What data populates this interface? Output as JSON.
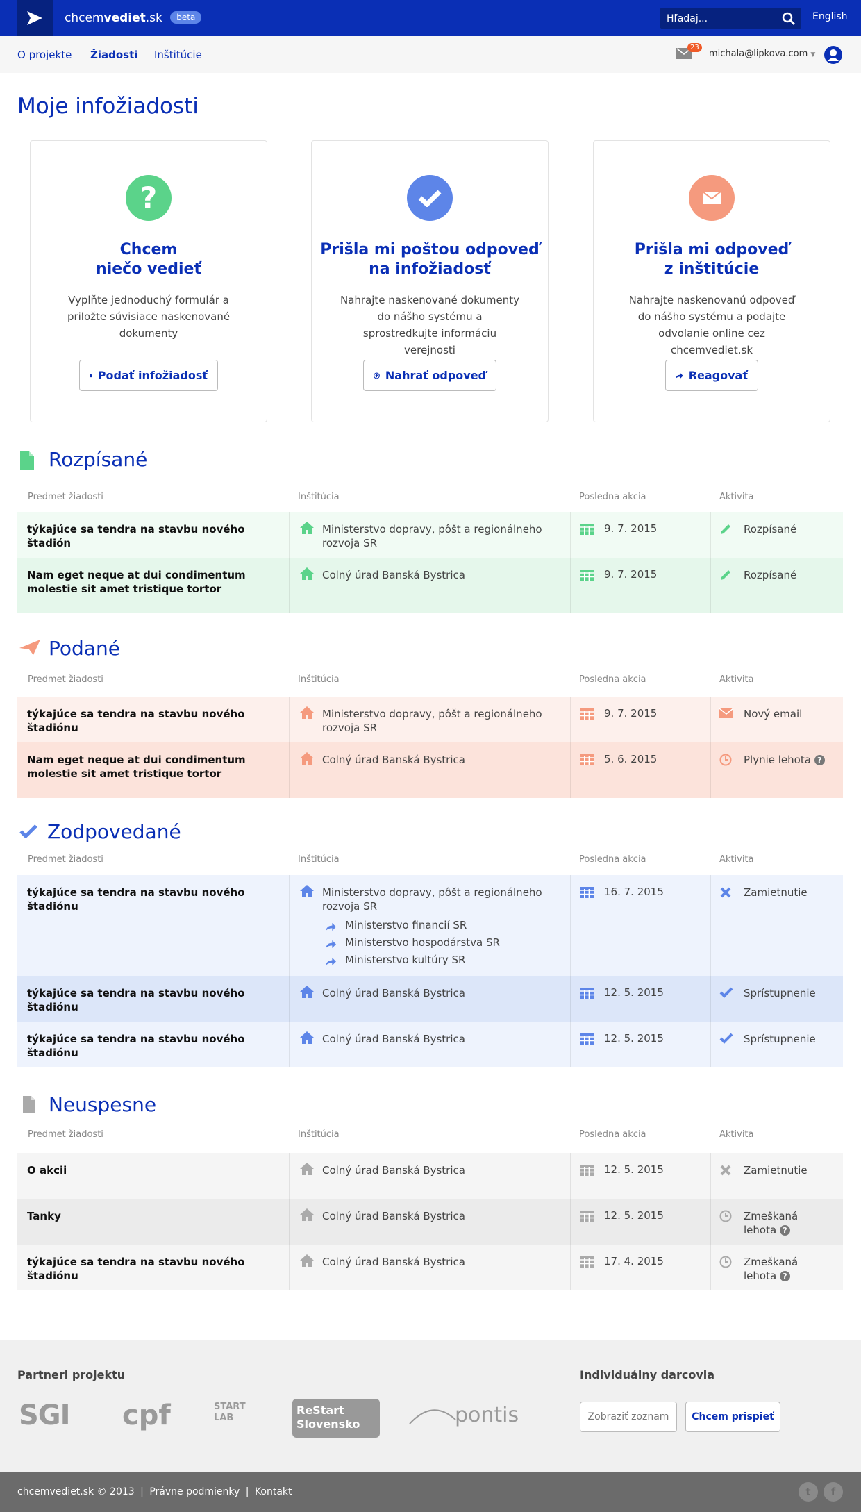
{
  "header": {
    "brand_light": "chcem",
    "brand_bold": "vediet",
    "brand_tld": ".sk",
    "beta": "beta",
    "search_placeholder": "Hľadaj...",
    "lang": "English"
  },
  "nav": {
    "items": [
      "O projekte",
      "Žiadosti",
      "Inštitúcie"
    ],
    "mail_count": "23",
    "user": "michala@lipkova.com"
  },
  "page_title": "Moje infožiadosti",
  "cards": [
    {
      "title1": "Chcem",
      "title2": "niečo vedieť",
      "text": "Vyplňte jednoduchý formulár a priložte súvisiace naskenované dokumenty",
      "button": "Podať infožiadosť",
      "color": "#5bd38a"
    },
    {
      "title1": "Prišla mi poštou odpoveď",
      "title2": "na infožiadosť",
      "text": "Nahrajte naskenované dokumenty do nášho systému a sprostredkujte informáciu verejnosti",
      "button": "Nahrať odpoveď",
      "color": "#5d85e8"
    },
    {
      "title1": "Prišla mi odpoveď",
      "title2": "z inštitúcie",
      "text": "Nahrajte naskenovanú odpoveď do nášho systému a podajte odvolanie online cez chcemvediet.sk",
      "button": "Reagovať",
      "color": "#f59a7e"
    }
  ],
  "table_headers": [
    "Predmet žiadosti",
    "Inštitúcia",
    "Posledna akcia",
    "Aktivita"
  ],
  "sections": {
    "rozpisane": {
      "title": "Rozpísané",
      "rows": [
        {
          "subject": "týkajúce sa tendra na stavbu nového štadión",
          "institution": "Ministerstvo dopravy, pôšt a regionálneho rozvoja SR",
          "date": "9. 7. 2015",
          "activity": "Rozpísané"
        },
        {
          "subject": "Nam eget neque at dui condimentum molestie sit amet tristique tortor",
          "institution": "Colný úrad Banská Bystrica",
          "date": "9. 7. 2015",
          "activity": "Rozpísané"
        }
      ]
    },
    "podane": {
      "title": "Podané",
      "rows": [
        {
          "subject": "týkajúce sa tendra na stavbu nového štadiónu",
          "institution": "Ministerstvo dopravy, pôšt a regionálneho rozvoja SR",
          "date": "9. 7. 2015",
          "activity": "Nový email"
        },
        {
          "subject": "Nam eget neque at dui condimentum molestie sit amet tristique tortor",
          "institution": "Colný úrad Banská Bystrica",
          "date": "5. 6. 2015",
          "activity": "Plynie lehota"
        }
      ]
    },
    "zodpovedane": {
      "title": "Zodpovedané",
      "rows": [
        {
          "subject": "týkajúce sa tendra na stavbu nového štadiónu",
          "institution": "Ministerstvo dopravy, pôšt a regionálneho rozvoja SR",
          "date": "16. 7. 2015",
          "activity": "Zamietnutie",
          "forwards": [
            "Ministerstvo financií SR",
            "Ministerstvo hospodárstva SR",
            "Ministerstvo kultúry SR"
          ]
        },
        {
          "subject": "týkajúce sa tendra na stavbu nového štadiónu",
          "institution": "Colný úrad Banská Bystrica",
          "date": "12. 5. 2015",
          "activity": "Sprístupnenie"
        },
        {
          "subject": "týkajúce sa tendra na stavbu nového štadiónu",
          "institution": "Colný úrad Banská Bystrica",
          "date": "12. 5. 2015",
          "activity": "Sprístupnenie"
        }
      ]
    },
    "neuspesne": {
      "title": "Neuspesne",
      "rows": [
        {
          "subject": "O akcii",
          "institution": "Colný úrad Banská Bystrica",
          "date": "12. 5. 2015",
          "activity": "Zamietnutie"
        },
        {
          "subject": "Tanky",
          "institution": "Colný úrad Banská Bystrica",
          "date": "12. 5. 2015",
          "activity1": "Zmeškaná",
          "activity2": "lehota"
        },
        {
          "subject": "týkajúce sa tendra na stavbu nového štadiónu",
          "institution": "Colný úrad Banská Bystrica",
          "date": "17. 4. 2015",
          "activity1": "Zmeškaná",
          "activity2": "lehota"
        }
      ]
    }
  },
  "footer": {
    "partners_title": "Partneri projektu",
    "partners": [
      "SGI",
      "cpf",
      "START LAB",
      "ReStart Slovensko",
      "pontis"
    ],
    "donors_title": "Individuálny darcovia",
    "btn_list": "Zobraziť zoznam",
    "btn_contribute": "Chcem prispieť",
    "copyright": "chcemvediet.sk © 2013",
    "terms": "Právne podmienky",
    "contact": "Kontakt",
    "help_glyph": "?"
  }
}
